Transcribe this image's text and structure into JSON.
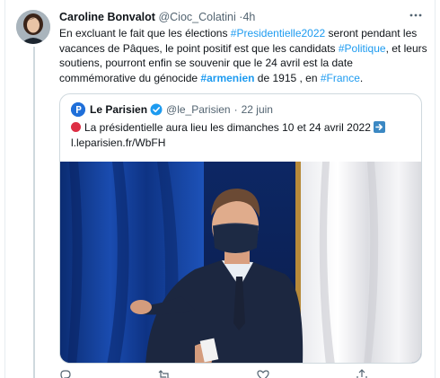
{
  "tweet": {
    "author_name": "Caroline Bonvalot",
    "author_handle": "@Cioc_Colatini",
    "separator": "·",
    "timestamp": "4h",
    "text": {
      "part1": "En excluant le fait que les élections ",
      "hashtag1": "#Presidentielle2022",
      "part2": " seront pendant les vacances de Pâques, le point positif est que les candidats ",
      "hashtag2": "#Politique",
      "part3": ", et leurs soutiens, pourront enfin se souvenir que le 24 avril est la date commémorative du génocide ",
      "hashtag3": "#armenien",
      "part4": " de 1915 , en ",
      "hashtag4": "#France",
      "part5": "."
    }
  },
  "quote": {
    "name": "Le Parisien",
    "handle": "@le_Parisien",
    "separator": "·",
    "timestamp": "22 juin",
    "text": "La présidentielle aura lieu les dimanches 10 et 24 avril 2022",
    "link": "l.leparisien.fr/WbFH"
  },
  "icons": {
    "more": "more-horizontal-icon",
    "verified": "verified-badge-icon",
    "logo": "le-parisien-logo-icon",
    "red_circle": "red-circle-emoji-icon",
    "arrow": "right-arrow-emoji-icon",
    "reply": "reply-icon",
    "retweet": "retweet-icon",
    "like": "like-icon",
    "share": "share-icon"
  },
  "colors": {
    "link": "#1d9bf0",
    "text": "#0f1419",
    "muted": "#536471",
    "border": "#cfd9de",
    "verified": "#1d9bf0",
    "curtain_blue": "#123a8a"
  }
}
